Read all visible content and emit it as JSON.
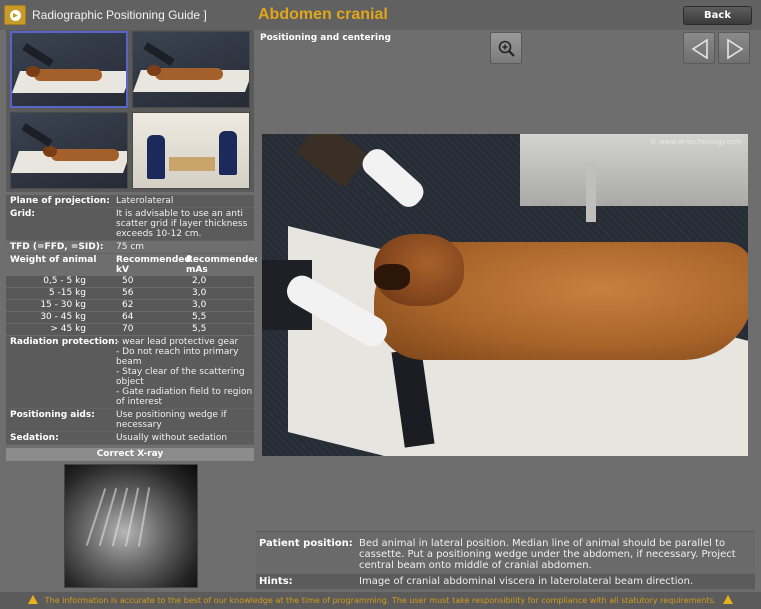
{
  "header": {
    "app_title": "Radiographic Positioning Guide ]",
    "page_title": "Abdomen cranial",
    "back_label": "Back"
  },
  "viewer": {
    "section_title": "Positioning and centering",
    "copyright": "© www.or-technology.com"
  },
  "properties": {
    "plane_label": "Plane of projection:",
    "plane_value": "Laterolateral",
    "grid_label": "Grid:",
    "grid_value": "It is advisable to use an anti scatter grid if layer thickness exceeds 10-12 cm.",
    "tfd_label": "TFD (=FFD, =SID):",
    "tfd_value": "75 cm",
    "weight_label": "Weight of animal",
    "kv_header": "Recommended kV",
    "mas_header": "Recommended mAs",
    "weights": [
      {
        "weight": "0,5 - 5 kg",
        "kv": "50",
        "mas": "2,0"
      },
      {
        "weight": "5 -15 kg",
        "kv": "56",
        "mas": "3,0"
      },
      {
        "weight": "15 - 30 kg",
        "kv": "62",
        "mas": "3,0"
      },
      {
        "weight": "30 - 45 kg",
        "kv": "64",
        "mas": "5,5"
      },
      {
        "weight": "> 45 kg",
        "kv": "70",
        "mas": "5,5"
      }
    ],
    "radiation_label": "Radiation protection:",
    "radiation_items": [
      "- wear lead protective gear",
      "- Do not reach into primary beam",
      "- Stay clear of the scattering object",
      "- Gate radiation field to region of interest"
    ],
    "aids_label": "Positioning aids:",
    "aids_value": "Use positioning wedge if necessary",
    "sedation_label": "Sedation:",
    "sedation_value": "Usually without sedation"
  },
  "xray": {
    "header": "Correct X-ray"
  },
  "info": {
    "patient_label": "Patient position:",
    "patient_value": "Bed animal in lateral position. Median line of animal should be parallel to cassette. Put a positioning wedge under the abdomen, if necessary. Project central beam onto middle of cranial abdomen.",
    "hints_label": "Hints:",
    "hints_value": "Image of cranial abdominal viscera in laterolateral beam direction."
  },
  "footer": {
    "disclaimer": "The information is accurate to the best of our knowledge at the time of programming. The user must take responsibility for compliance with all statutory requirements."
  },
  "icons": {
    "logo": "play-circle-icon",
    "zoom": "zoom-in-icon",
    "prev": "triangle-left-icon",
    "next": "triangle-right-icon",
    "warning": "warning-triangle-icon"
  },
  "colors": {
    "accent": "#e0a619",
    "selected_thumb": "#5a63c8",
    "footer_text": "#d49c1a"
  }
}
